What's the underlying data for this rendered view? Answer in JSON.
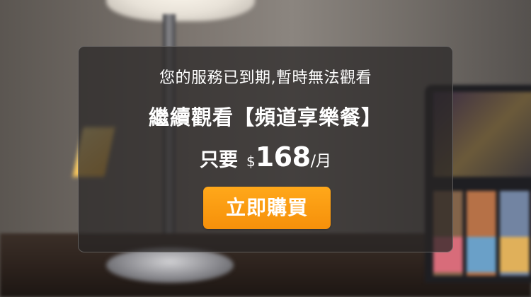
{
  "dialog": {
    "message": "您的服務已到期,暫時無法觀看",
    "headline": "繼續觀看【頻道享樂餐】",
    "price": {
      "prefix": "只要",
      "currency": "$",
      "amount": "168",
      "period": "/月"
    },
    "buy_label": "立即購買"
  },
  "colors": {
    "button": "#f79a10",
    "dialog_bg": "rgba(40,38,38,0.72)",
    "text": "#ffffff"
  }
}
